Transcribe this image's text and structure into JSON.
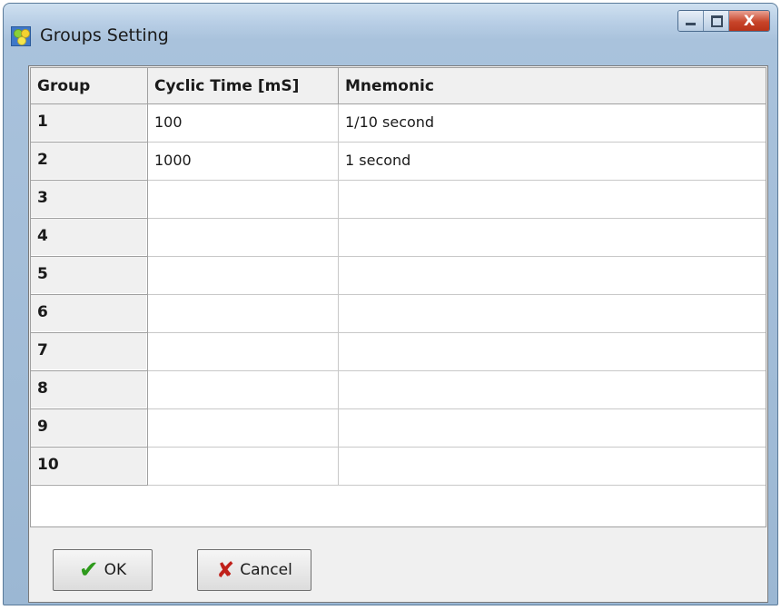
{
  "window": {
    "title": "Groups Setting",
    "icon": "app-icon",
    "controls": {
      "minimize": "minimize-icon",
      "maximize": "maximize-icon",
      "close": "close-icon",
      "close_glyph": "X"
    }
  },
  "grid": {
    "columns": [
      "Group",
      "Cyclic Time [mS]",
      "Mnemonic"
    ],
    "rows": [
      {
        "group": "1",
        "cyclic_time": "100",
        "mnemonic": "1/10 second"
      },
      {
        "group": "2",
        "cyclic_time": "1000",
        "mnemonic": "1 second"
      },
      {
        "group": "3",
        "cyclic_time": "",
        "mnemonic": ""
      },
      {
        "group": "4",
        "cyclic_time": "",
        "mnemonic": ""
      },
      {
        "group": "5",
        "cyclic_time": "",
        "mnemonic": ""
      },
      {
        "group": "6",
        "cyclic_time": "",
        "mnemonic": ""
      },
      {
        "group": "7",
        "cyclic_time": "",
        "mnemonic": ""
      },
      {
        "group": "8",
        "cyclic_time": "",
        "mnemonic": ""
      },
      {
        "group": "9",
        "cyclic_time": "",
        "mnemonic": ""
      },
      {
        "group": "10",
        "cyclic_time": "",
        "mnemonic": ""
      }
    ]
  },
  "buttons": {
    "ok": {
      "label": "OK",
      "icon": "checkmark-icon",
      "glyph": "✔"
    },
    "cancel": {
      "label": "Cancel",
      "icon": "cancel-x-icon",
      "glyph": "✘"
    }
  },
  "colors": {
    "check": "#2e9a1c",
    "cancel_x": "#c0201a",
    "titlebar": "#b9cfe6"
  }
}
